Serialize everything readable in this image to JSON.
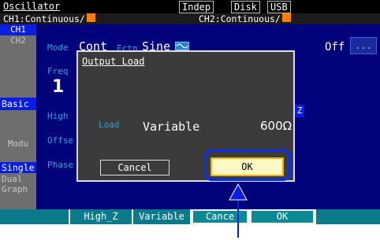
{
  "topbar": {
    "title": "Oscillator",
    "indep": "Indep",
    "disk": "Disk",
    "usb": "USB"
  },
  "status": {
    "ch1": "CH1:Continuous/",
    "ch2": "CH2:Continuous/"
  },
  "side": {
    "ch1": "CH1",
    "ch2": "CH2",
    "basic": "Basic",
    "modu": "Modu",
    "single": "Single",
    "dual": "Dual",
    "graph": "Graph"
  },
  "params": {
    "mode_label": "Mode",
    "mode_value": "Cont",
    "fctn_label": "Fctn",
    "fctn_value": "Sine",
    "freq_label": "Freq",
    "freq_value": "1",
    "high_label": "High",
    "offset_label": "Offse",
    "phase_label": "Phase",
    "output_state": "Off",
    "more": "...",
    "z_suffix": "Z"
  },
  "dialog": {
    "title": "Output Load",
    "load_label": "Load",
    "load_mode": "Variable",
    "load_value": "600Ω",
    "cancel": "Cancel",
    "ok": "OK"
  },
  "softkeys": {
    "k1": "",
    "k2": "High_Z",
    "k3": "Variable",
    "k4": "Cance",
    "k5": "OK",
    "k6": ""
  },
  "colors": {
    "screen_bg": "#02037a",
    "highlight": "#0a1de0",
    "ok_fill": "#fff7c6",
    "orange": "#ff7f00"
  }
}
